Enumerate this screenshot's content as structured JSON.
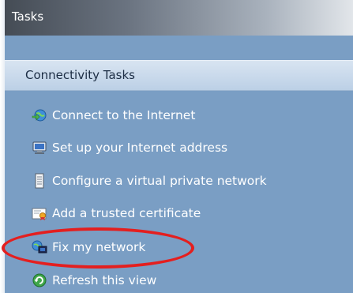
{
  "header": {
    "title": "Tasks"
  },
  "section": {
    "title": "Connectivity Tasks"
  },
  "tasks": [
    {
      "label": "Connect to the Internet",
      "icon": "globe-connect-icon"
    },
    {
      "label": "Set up your Internet address",
      "icon": "computer-address-icon"
    },
    {
      "label": "Configure a virtual private network",
      "icon": "vpn-document-icon"
    },
    {
      "label": "Add a trusted certificate",
      "icon": "certificate-icon"
    },
    {
      "label": "Fix my network",
      "icon": "network-repair-icon"
    },
    {
      "label": "Refresh this view",
      "icon": "refresh-icon"
    }
  ],
  "colors": {
    "panel": "#7a9ec4",
    "section": "#c8d8eb",
    "highlight_ring": "#e41f1f"
  }
}
